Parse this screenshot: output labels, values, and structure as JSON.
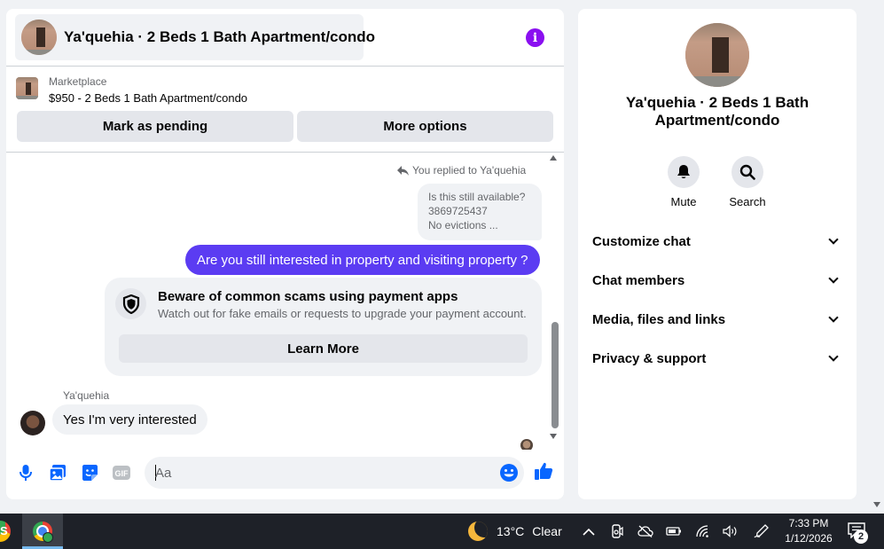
{
  "chat": {
    "title": "Ya'quehia · 2 Beds 1 Bath Apartment/condo",
    "info_icon": "info-icon",
    "listing": {
      "source": "Marketplace",
      "title": "$950 - 2 Beds 1 Bath Apartment/condo",
      "mark_pending_label": "Mark as pending",
      "more_options_label": "More options"
    },
    "messages": {
      "replied_label": "You replied to Ya'quehia",
      "quoted_lines": [
        "Is this still available?",
        "3869725437",
        "No evictions ..."
      ],
      "outgoing": "Are you still interested in property and visiting property ?",
      "scam_notice": {
        "title": "Beware of common scams using payment apps",
        "body": "Watch out for fake emails or requests to upgrade your payment account.",
        "button": "Learn More"
      },
      "sender_name": "Ya'quehia",
      "incoming": "Yes I'm very interested"
    },
    "composer": {
      "placeholder": "Aa",
      "icons": [
        "microphone-icon",
        "photo-icon",
        "sticker-icon",
        "gif-icon",
        "emoji-icon",
        "thumbs-up-icon"
      ],
      "gif_label": "GIF"
    },
    "accent_color": "#5b3cf2"
  },
  "info_panel": {
    "title": "Ya'quehia · 2 Beds 1 Bath Apartment/condo",
    "actions": [
      {
        "label": "Mute",
        "icon": "bell-icon"
      },
      {
        "label": "Search",
        "icon": "search-icon"
      }
    ],
    "sections": [
      "Customize chat",
      "Chat members",
      "Media, files and links",
      "Privacy & support"
    ]
  },
  "taskbar": {
    "app1_label": "S",
    "weather": {
      "temperature": "13°C",
      "condition": "Clear"
    },
    "clock": {
      "time": "7:33 PM",
      "date": "1/12/2026"
    },
    "notification_count": "2"
  }
}
